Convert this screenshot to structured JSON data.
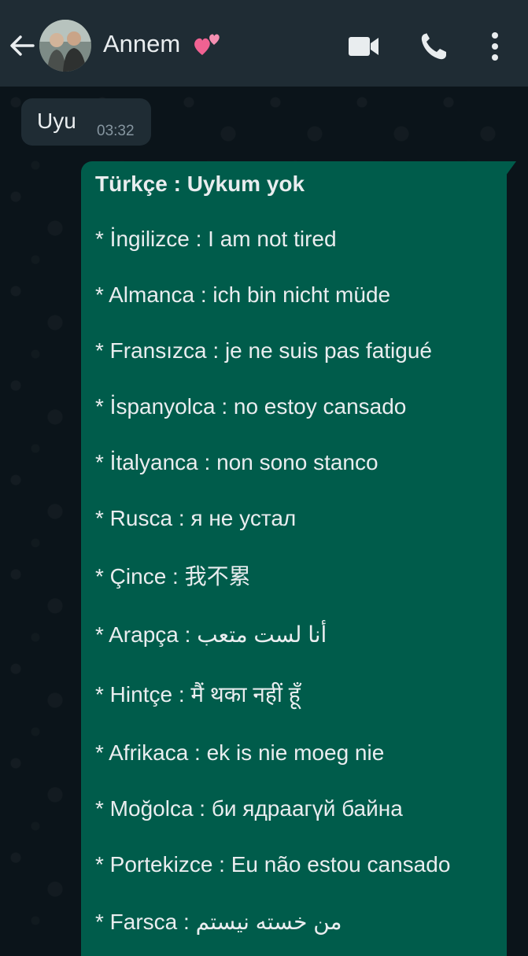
{
  "header": {
    "contact_name": "Annem",
    "icons": [
      "back-arrow-icon",
      "avatar",
      "two-hearts-icon",
      "video-call-icon",
      "phone-call-icon",
      "more-options-icon"
    ]
  },
  "messages": {
    "incoming": {
      "text": "Uyu",
      "time": "03:32"
    },
    "outgoing": {
      "title": "Türkçe : Uykum yok",
      "lines": [
        "* İngilizce : I am not tired",
        "* Almanca : ich bin nicht müde",
        "* Fransızca : je ne suis pas fatigué",
        "* İspanyolca : no estoy cansado",
        "* İtalyanca : non sono stanco",
        "* Rusca : я не устал",
        "* Çince : 我不累",
        "* Arapça : أنا لست متعب",
        "* Hintçe : मैं थका नहीं हूँ",
        "* Afrikaca : ek is nie moeg nie",
        "* Moğolca : би ядраагүй байна",
        "* Portekizce : Eu não estou cansado",
        "* Farsca : من خسته نیستم"
      ]
    }
  },
  "colors": {
    "header_bg": "#1f2c34",
    "chat_bg": "#0b141a",
    "incoming_bubble": "#1f2c34",
    "outgoing_bubble": "#005c4b",
    "text": "#e9edef",
    "meta_text": "#8696a0"
  }
}
